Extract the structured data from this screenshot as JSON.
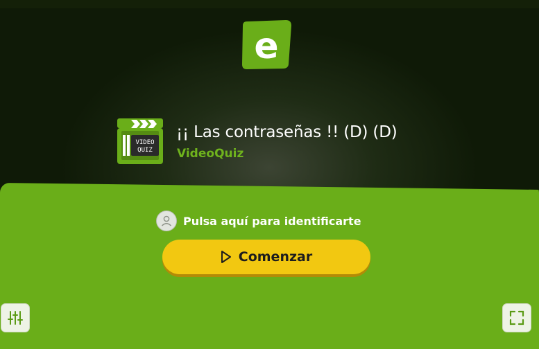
{
  "app": {
    "logo_letter": "e",
    "brand_color": "#6aae19",
    "accent_color": "#f2c811"
  },
  "activity": {
    "icon": "video-clapperboard-icon",
    "icon_text_line1": "VIDEO",
    "icon_text_line2": "QUIZ",
    "title": "¡¡ Las contraseñas !! (D) (D)",
    "type_label": "VideoQuiz"
  },
  "panel": {
    "identify_label": "Pulsa aquí para identificarte",
    "identify_icon": "user-avatar-icon",
    "start_label": "Comenzar",
    "start_icon": "play-icon"
  },
  "controls": {
    "settings_icon": "sliders-icon",
    "fullscreen_icon": "fullscreen-icon"
  }
}
